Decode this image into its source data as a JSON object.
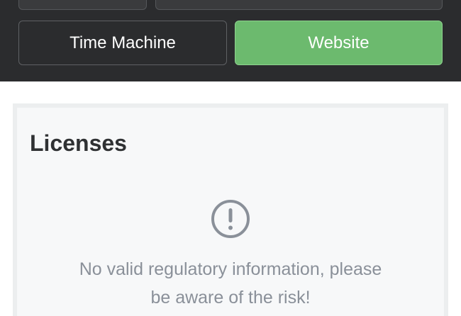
{
  "actions": {
    "time_machine_label": "Time Machine",
    "website_label": "Website"
  },
  "licenses": {
    "title": "Licenses",
    "icon": "exclamation-circle-icon",
    "notice_line1": "No valid regulatory information, please",
    "notice_line2": "be aware of the risk!"
  },
  "colors": {
    "dark_panel": "#2b2c2e",
    "website_button": "#6cba6e",
    "notice_text": "#8a9099",
    "card_background": "#f7f8f9"
  }
}
